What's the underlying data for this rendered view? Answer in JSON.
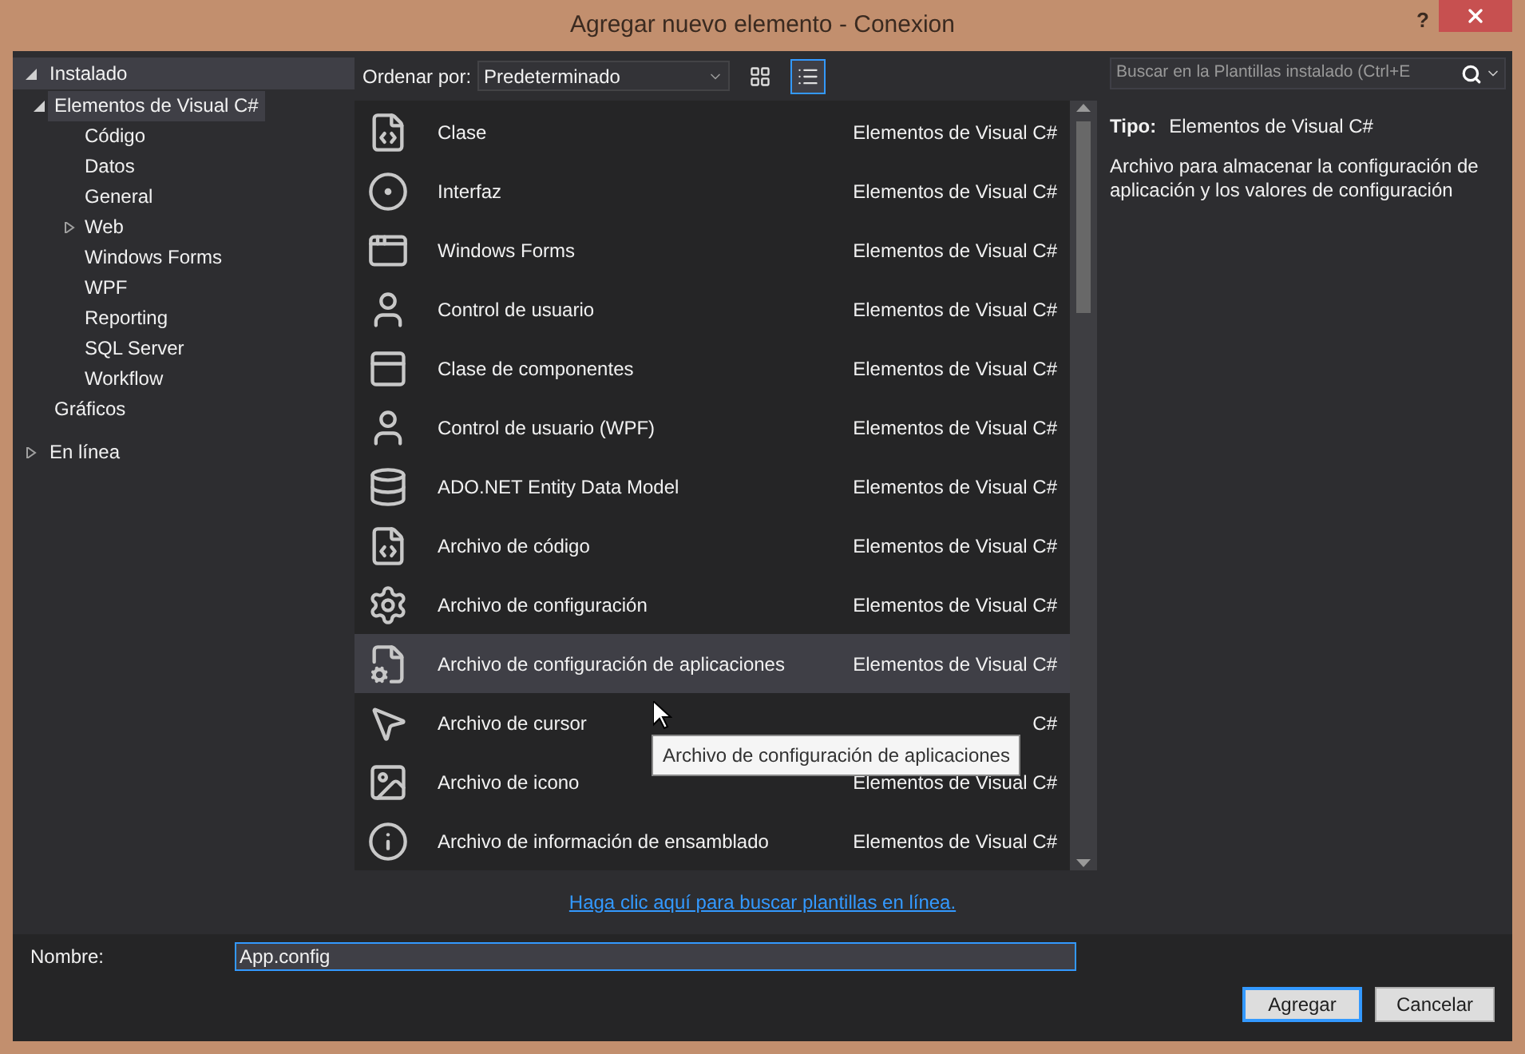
{
  "window": {
    "title": "Agregar nuevo elemento - Conexion",
    "help": "?"
  },
  "sidebar": {
    "sections": [
      {
        "label": "Instalado",
        "expanded": true,
        "items": [
          {
            "label": "Elementos de Visual C#",
            "expanded": true,
            "selected": true,
            "children": [
              {
                "label": "Código",
                "selected": false
              },
              {
                "label": "Datos",
                "selected": false
              },
              {
                "label": "General",
                "selected": false
              },
              {
                "label": "Web",
                "expanded": false,
                "selected": false
              },
              {
                "label": "Windows Forms",
                "selected": false
              },
              {
                "label": "WPF",
                "selected": false
              },
              {
                "label": "Reporting",
                "selected": false
              },
              {
                "label": "SQL Server",
                "selected": false
              },
              {
                "label": "Workflow",
                "selected": false
              }
            ]
          },
          {
            "label": "Gráficos",
            "selected": false
          }
        ]
      },
      {
        "label": "En línea",
        "expanded": false
      }
    ]
  },
  "toolbar": {
    "sort_label": "Ordenar por:",
    "sort_value": "Predeterminado",
    "views": [
      {
        "kind": "grid",
        "selected": false
      },
      {
        "kind": "list",
        "selected": true
      }
    ],
    "search": {
      "placeholder": "Buscar en la Plantillas instalado (Ctrl+E"
    }
  },
  "templates": [
    {
      "name": "Clase",
      "category": "Elementos de Visual C#",
      "selected": false
    },
    {
      "name": "Interfaz",
      "category": "Elementos de Visual C#",
      "selected": false
    },
    {
      "name": "Windows Forms",
      "category": "Elementos de Visual C#",
      "selected": false
    },
    {
      "name": "Control de usuario",
      "category": "Elementos de Visual C#",
      "selected": false
    },
    {
      "name": "Clase de componentes",
      "category": "Elementos de Visual C#",
      "selected": false
    },
    {
      "name": "Control de usuario (WPF)",
      "category": "Elementos de Visual C#",
      "selected": false
    },
    {
      "name": "ADO.NET Entity Data Model",
      "category": "Elementos de Visual C#",
      "selected": false
    },
    {
      "name": "Archivo de código",
      "category": "Elementos de Visual C#",
      "selected": false
    },
    {
      "name": "Archivo de configuración",
      "category": "Elementos de Visual C#",
      "selected": false
    },
    {
      "name": "Archivo de configuración de aplicaciones",
      "category": "Elementos de Visual C#",
      "selected": true
    },
    {
      "name": "Archivo de cursor",
      "category": "C#",
      "selected": false
    },
    {
      "name": "Archivo de icono",
      "category": "Elementos de Visual C#",
      "selected": false
    },
    {
      "name": "Archivo de información de ensamblado",
      "category": "Elementos de Visual C#",
      "selected": false
    }
  ],
  "tooltip": "Archivo de configuración de aplicaciones",
  "details": {
    "type_label": "Tipo:",
    "type_value": "Elementos de Visual C#",
    "description": "Archivo para almacenar la configuración de aplicación y los valores de configuración"
  },
  "online_link": "Haga clic aquí para buscar plantillas en línea.",
  "name_field": {
    "label": "Nombre:",
    "value": "App.config"
  },
  "buttons": [
    {
      "label": "Agregar",
      "default": true
    },
    {
      "label": "Cancelar",
      "default": false
    }
  ]
}
